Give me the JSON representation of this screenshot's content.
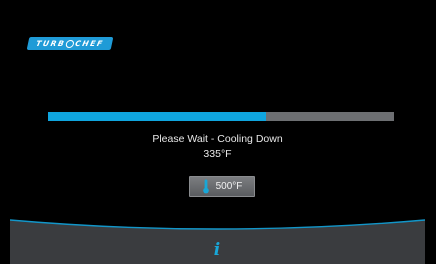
{
  "colors": {
    "accent": "#0fa5de",
    "track": "#6d6f72",
    "background": "#000000",
    "bottom_bar": "#3a3c3f",
    "logo_bg": "#1f9bd7"
  },
  "header": {
    "logo_text_left": "TURB",
    "logo_text_right": "CHEF"
  },
  "progress": {
    "fraction": 0.63
  },
  "status": {
    "message": "Please Wait - Cooling Down",
    "current_temperature": "335°F"
  },
  "setpoint": {
    "label": "500°F",
    "icon": "thermometer-icon"
  },
  "footer": {
    "info_icon": "info-icon",
    "info_glyph": "i"
  }
}
